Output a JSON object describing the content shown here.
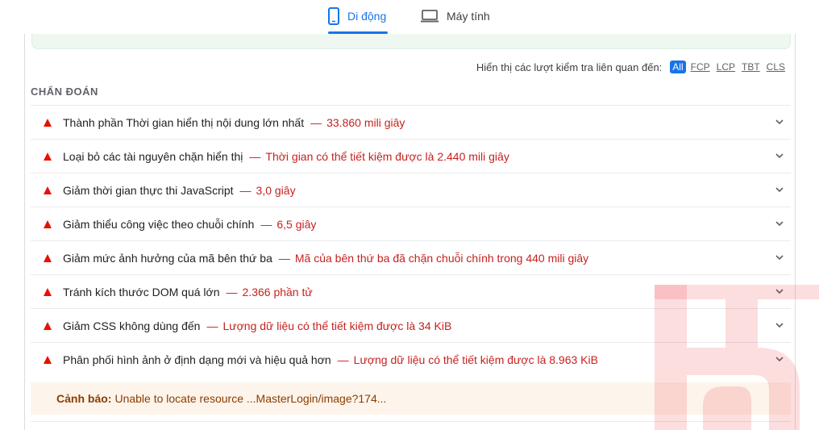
{
  "tabs": [
    {
      "label": "Di động",
      "icon": "smartphone-icon",
      "active": true
    },
    {
      "label": "Máy tính",
      "icon": "laptop-icon",
      "active": false
    }
  ],
  "filter": {
    "label": "Hiển thị các lượt kiểm tra liên quan đến:",
    "options": [
      "All",
      "FCP",
      "LCP",
      "TBT",
      "CLS"
    ],
    "selected": "All"
  },
  "section_title": "CHẨN ĐOÁN",
  "audits": [
    {
      "title": "Thành phần Thời gian hiển thị nội dung lớn nhất",
      "detail": "33.860 mili giây"
    },
    {
      "title": "Loại bỏ các tài nguyên chặn hiển thị",
      "detail": "Thời gian có thể tiết kiệm được là 2.440 mili giây"
    },
    {
      "title": "Giảm thời gian thực thi JavaScript",
      "detail": "3,0 giây"
    },
    {
      "title": "Giảm thiểu công việc theo chuỗi chính",
      "detail": "6,5 giây"
    },
    {
      "title": "Giảm mức ảnh hưởng của mã bên thứ ba",
      "detail": "Mã của bên thứ ba đã chặn chuỗi chính trong 440 mili giây"
    },
    {
      "title": "Tránh kích thước DOM quá lớn",
      "detail": "2.366 phần tử"
    },
    {
      "title": "Giảm CSS không dùng đến",
      "detail": "Lượng dữ liệu có thể tiết kiệm được là 34 KiB"
    },
    {
      "title": "Phân phối hình ảnh ở định dạng mới và hiệu quả hơn",
      "detail": "Lượng dữ liệu có thể tiết kiệm được là 8.963 KiB"
    }
  ],
  "audit_separator": "—",
  "warning": {
    "label": "Cảnh báo:",
    "text": "Unable to locate resource ...MasterLogin/image?174..."
  },
  "colors": {
    "accent": "#1a73e8",
    "fail": "#eb0f00",
    "fail_text": "#c5221f",
    "warning_bg": "#fdf4ec",
    "warning_text": "#8a3d00",
    "watermark": "#e8151b"
  }
}
